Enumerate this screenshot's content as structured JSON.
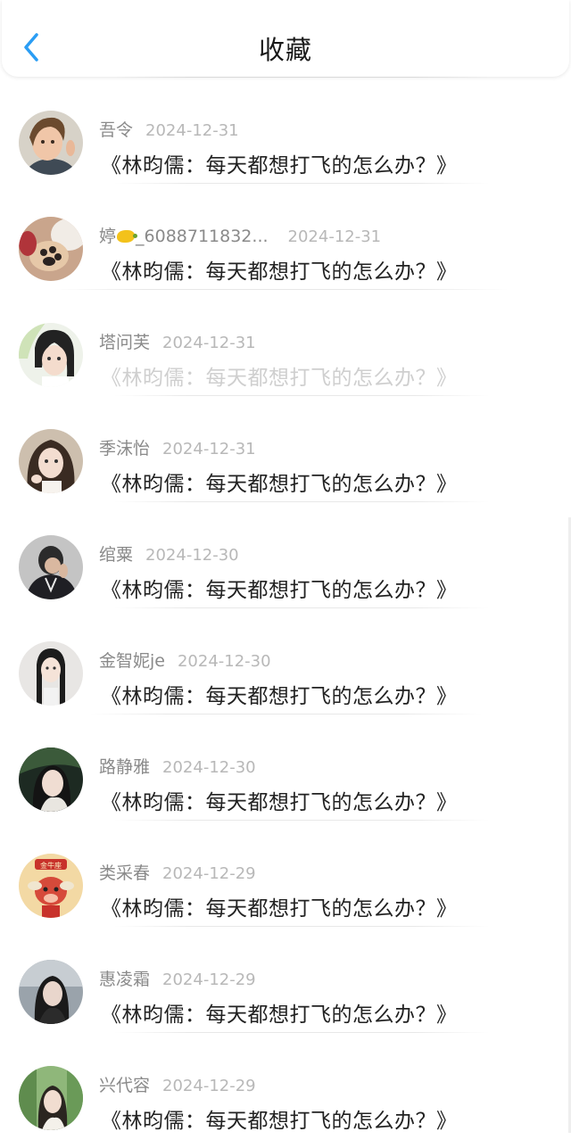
{
  "header": {
    "title": "收藏",
    "back_icon": "chevron-left-icon",
    "accent_color": "#2a9df4"
  },
  "items": [
    {
      "name": "吾令",
      "date": "2024-12-31",
      "title": "《林昀儒：每天都想打飞的怎么办？》",
      "avatar": "child-photo"
    },
    {
      "name_prefix": "婷",
      "name_icon": "lemon-emoji",
      "name": "_6088711832...",
      "date": "2024-12-31",
      "title": "《林昀儒：每天都想打飞的怎么办？》",
      "avatar": "paw-photo"
    },
    {
      "name": "塔问芙",
      "date": "2024-12-31",
      "title": "《林昀儒：每天都想打飞的怎么办？》",
      "avatar": "girl-photo",
      "faded": true
    },
    {
      "name": "季沫怡",
      "date": "2024-12-31",
      "title": "《林昀儒：每天都想打飞的怎么办？》",
      "avatar": "girl-photo"
    },
    {
      "name": "绾粟",
      "date": "2024-12-30",
      "title": "《林昀儒：每天都想打飞的怎么办？》",
      "avatar": "boy-photo"
    },
    {
      "name": "金智妮je",
      "date": "2024-12-30",
      "title": "《林昀儒：每天都想打飞的怎么办？》",
      "avatar": "girl-photo"
    },
    {
      "name": "路静雅",
      "date": "2024-12-30",
      "title": "《林昀儒：每天都想打飞的怎么办？》",
      "avatar": "girl-photo"
    },
    {
      "name": "类采春",
      "date": "2024-12-29",
      "title": "《林昀儒：每天都想打飞的怎么办？》",
      "avatar": "taurus-cartoon",
      "avatar_text": "金牛座"
    },
    {
      "name": "惠凌霜",
      "date": "2024-12-29",
      "title": "《林昀儒：每天都想打飞的怎么办？》",
      "avatar": "girl-photo"
    },
    {
      "name": "兴代容",
      "date": "2024-12-29",
      "title": "《林昀儒：每天都想打飞的怎么办？》",
      "avatar": "girl-photo"
    }
  ]
}
